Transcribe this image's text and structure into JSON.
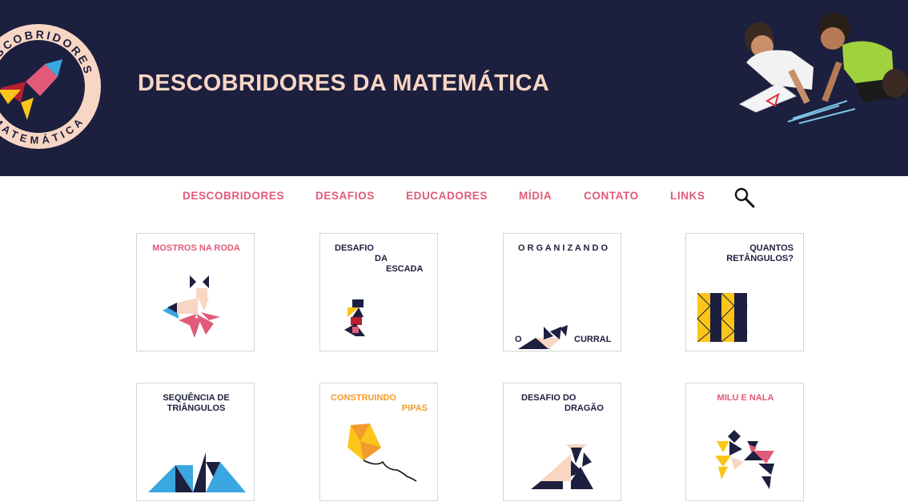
{
  "site": {
    "title": "DESCOBRIDORES DA MATEMÁTICA",
    "logo_text_top": "DESCOBRIDORES",
    "logo_text_bottom": "MATEMÁTICA"
  },
  "nav": {
    "items": [
      {
        "label": "DESCOBRIDORES"
      },
      {
        "label": "DESAFIOS"
      },
      {
        "label": "EDUCADORES"
      },
      {
        "label": "MÍDIA"
      },
      {
        "label": "CONTATO"
      },
      {
        "label": "LINKS"
      }
    ],
    "search_icon": "search-icon"
  },
  "cards": [
    {
      "title": "MOSTROS NA RODA",
      "color": "#e25a79"
    },
    {
      "line1": "DESAFIO",
      "line2": "DA",
      "line3": "ESCADA"
    },
    {
      "line1": "O R G A N I Z A N D O",
      "line2": "O",
      "line3": "CURRAL"
    },
    {
      "line1": "QUANTOS",
      "line2": "RETÂNGULOS?"
    },
    {
      "line1": "SEQUÊNCIA DE",
      "line2": "TRIÂNGULOS"
    },
    {
      "line1": "CONSTRUINDO",
      "line2": "PIPAS",
      "color": "#f39a2c"
    },
    {
      "line1": "DESAFIO DO",
      "line2": "DRAGÃO"
    },
    {
      "title": "MILU E NALA",
      "color": "#e25a79"
    }
  ],
  "colors": {
    "header_bg": "#1d1f3f",
    "title": "#f8d6c4",
    "accent_pink": "#e25a79",
    "yellow": "#fbc51a",
    "blue": "#3aa7e0",
    "navy": "#1d1f3f",
    "red": "#b8202f",
    "peach": "#f8d6c4"
  }
}
